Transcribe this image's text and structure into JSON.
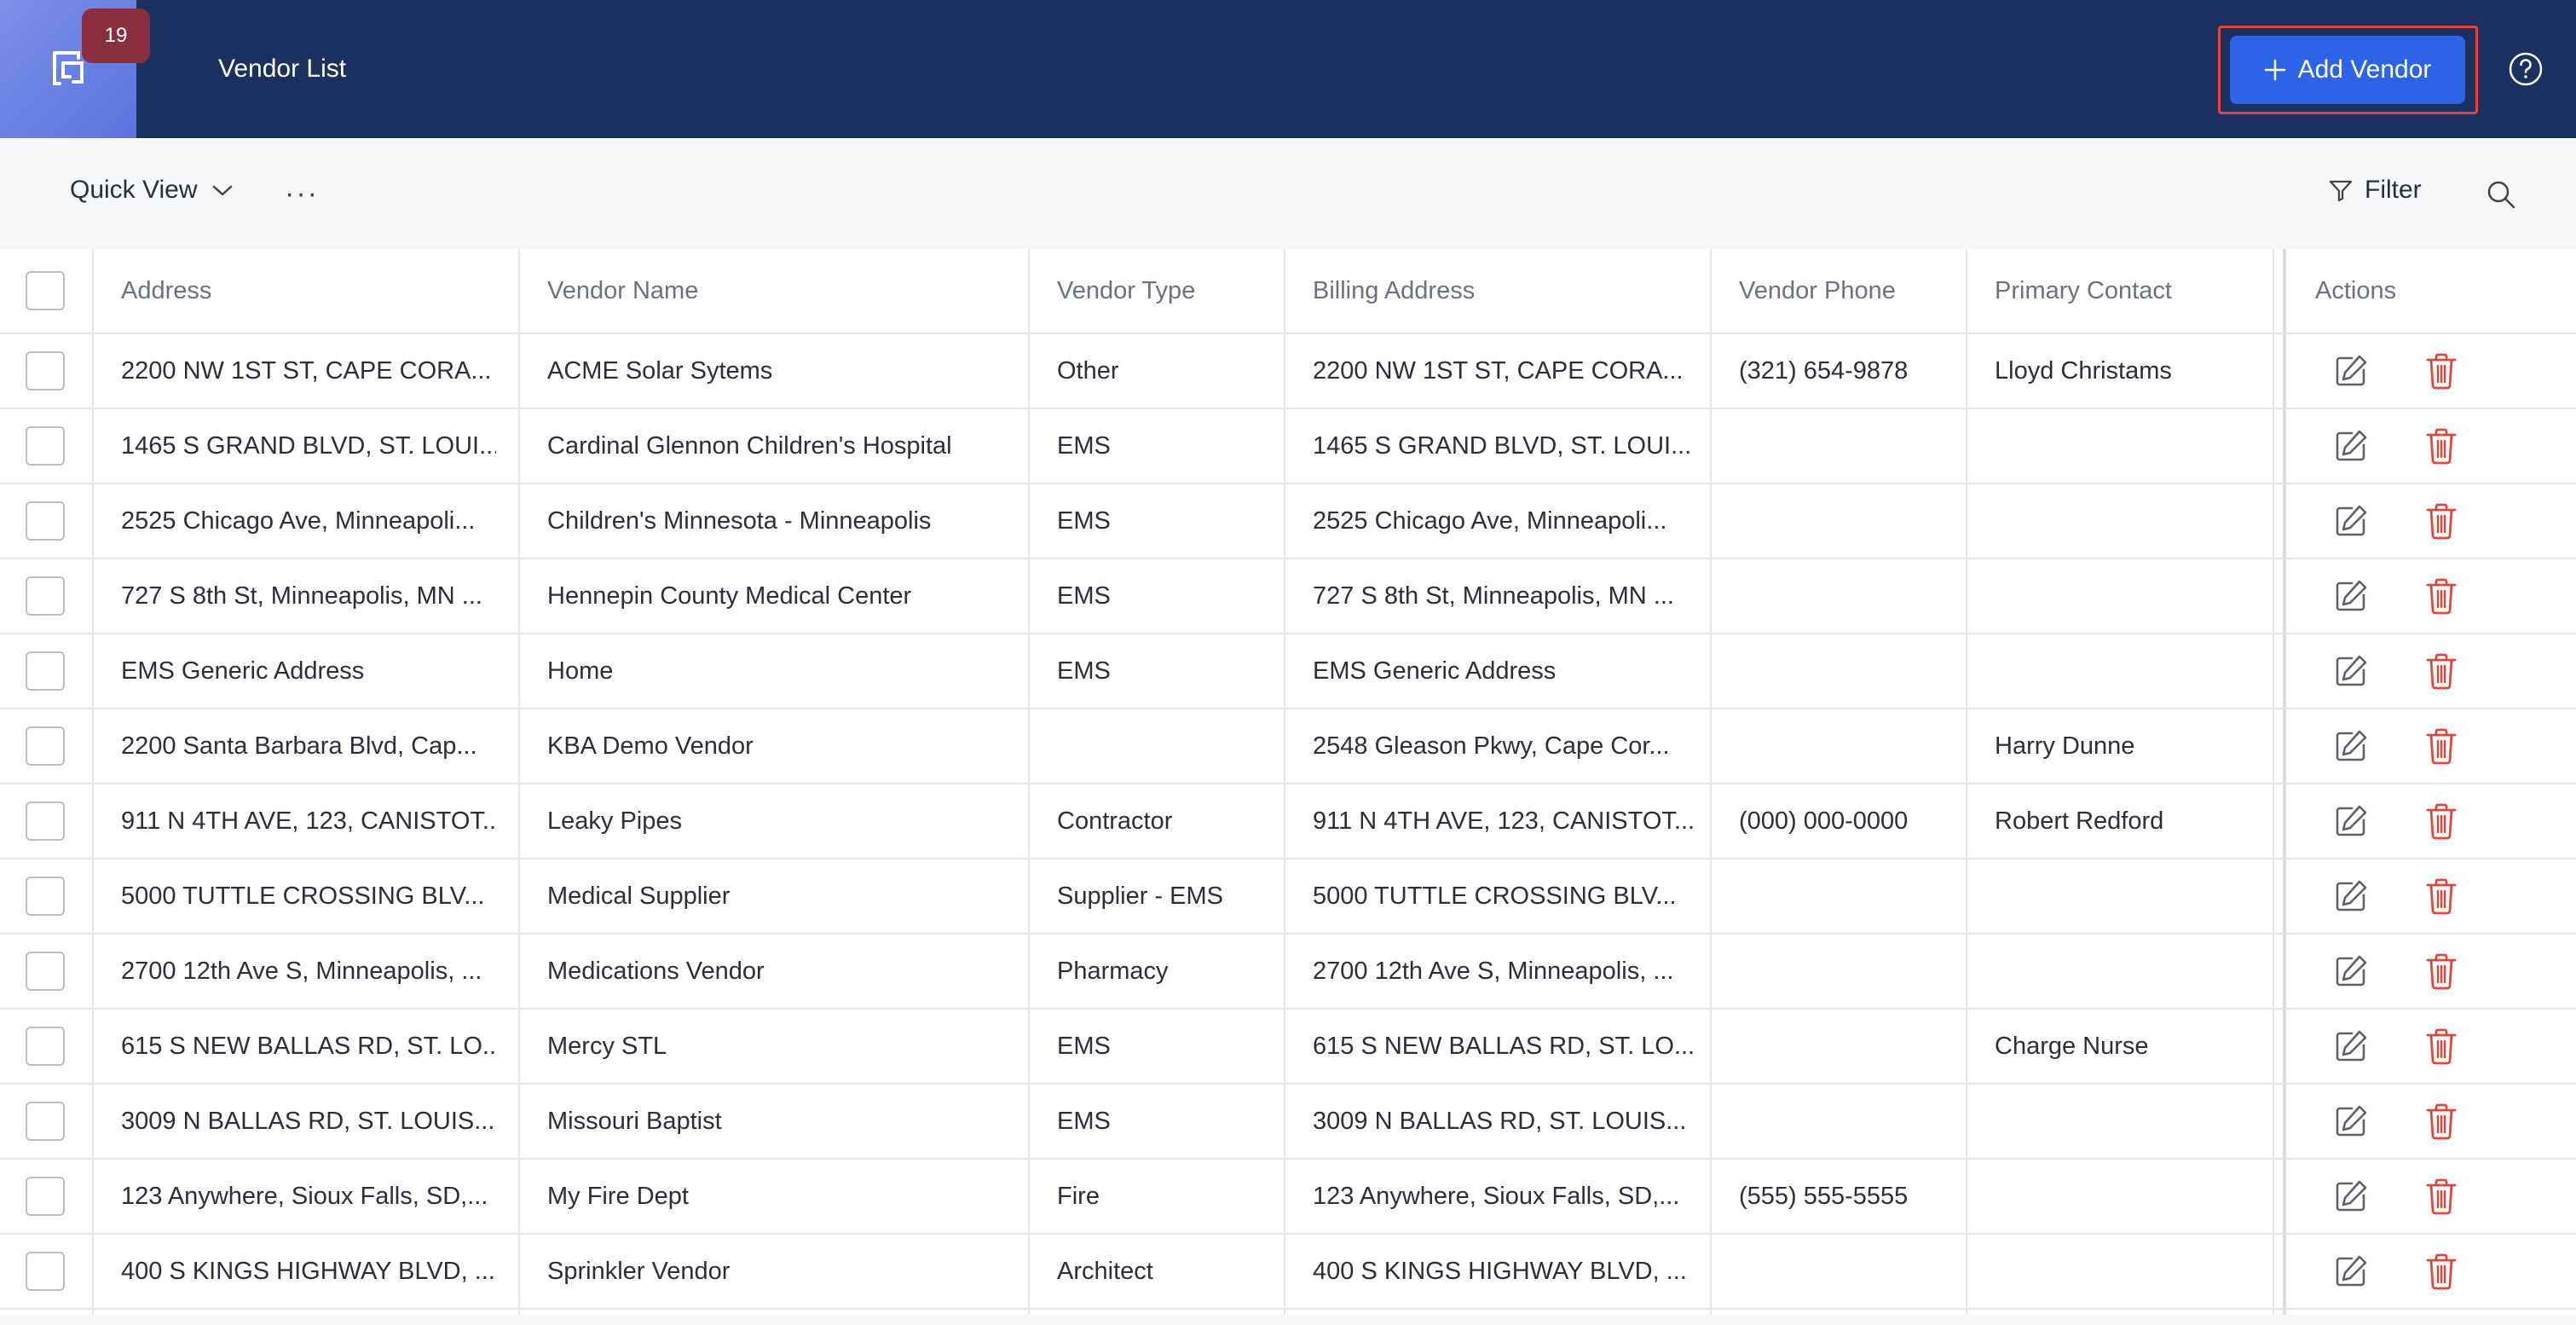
{
  "header": {
    "badge_count": "19",
    "title": "Vendor List",
    "add_vendor_label": "Add Vendor",
    "accent_color": "#2d63e6",
    "background_color": "#1d3160"
  },
  "toolbar": {
    "quick_view_label": "Quick View",
    "more_label": "···",
    "filter_label": "Filter"
  },
  "table": {
    "columns": [
      "Address",
      "Vendor Name",
      "Vendor Type",
      "Billing Address",
      "Vendor Phone",
      "Primary Contact",
      "Actions"
    ],
    "rows": [
      {
        "address": "2200 NW 1ST ST, CAPE CORA...",
        "name": "ACME Solar Sytems",
        "type": "Other",
        "billing": "2200 NW 1ST ST, CAPE CORA...",
        "phone": "(321) 654-9878",
        "contact": "Lloyd Christams"
      },
      {
        "address": "1465 S GRAND BLVD, ST. LOUI...",
        "name": "Cardinal Glennon Children's Hospital",
        "type": "EMS",
        "billing": "1465 S GRAND BLVD, ST. LOUI...",
        "phone": "",
        "contact": ""
      },
      {
        "address": "2525 Chicago Ave, Minneapoli...",
        "name": "Children's Minnesota - Minneapolis",
        "type": "EMS",
        "billing": "2525 Chicago Ave, Minneapoli...",
        "phone": "",
        "contact": ""
      },
      {
        "address": "727 S 8th St, Minneapolis, MN ...",
        "name": "Hennepin County Medical Center",
        "type": "EMS",
        "billing": "727 S 8th St, Minneapolis, MN ...",
        "phone": "",
        "contact": ""
      },
      {
        "address": "EMS Generic Address",
        "name": "Home",
        "type": "EMS",
        "billing": "EMS Generic Address",
        "phone": "",
        "contact": ""
      },
      {
        "address": "2200 Santa Barbara Blvd, Cap...",
        "name": "KBA Demo Vendor",
        "type": "",
        "billing": "2548 Gleason Pkwy, Cape Cor...",
        "phone": "",
        "contact": "Harry Dunne"
      },
      {
        "address": "911 N 4TH AVE, 123, CANISTOT...",
        "name": "Leaky Pipes",
        "type": "Contractor",
        "billing": "911 N 4TH AVE, 123, CANISTOT...",
        "phone": "(000) 000-0000",
        "contact": "Robert Redford"
      },
      {
        "address": "5000 TUTTLE CROSSING BLV...",
        "name": "Medical Supplier",
        "type": "Supplier - EMS",
        "billing": "5000 TUTTLE CROSSING BLV...",
        "phone": "",
        "contact": ""
      },
      {
        "address": "2700 12th Ave S, Minneapolis, ...",
        "name": "Medications Vendor",
        "type": "Pharmacy",
        "billing": "2700 12th Ave S, Minneapolis, ...",
        "phone": "",
        "contact": ""
      },
      {
        "address": "615 S NEW BALLAS RD, ST. LO...",
        "name": "Mercy STL",
        "type": "EMS",
        "billing": "615 S NEW BALLAS RD, ST. LO...",
        "phone": "",
        "contact": "Charge Nurse"
      },
      {
        "address": "3009 N BALLAS RD, ST. LOUIS...",
        "name": "Missouri Baptist",
        "type": "EMS",
        "billing": "3009 N BALLAS RD, ST. LOUIS...",
        "phone": "",
        "contact": ""
      },
      {
        "address": "123 Anywhere, Sioux Falls, SD,...",
        "name": "My Fire Dept",
        "type": "Fire",
        "billing": "123 Anywhere, Sioux Falls, SD,...",
        "phone": "(555) 555-5555",
        "contact": ""
      },
      {
        "address": "400 S KINGS HIGHWAY BLVD, ...",
        "name": "Sprinkler Vendor",
        "type": "Architect",
        "billing": "400 S KINGS HIGHWAY BLVD, ...",
        "phone": "",
        "contact": ""
      }
    ],
    "edit_icon": "edit-icon",
    "delete_icon": "trash-icon",
    "delete_color": "#e0463b"
  }
}
